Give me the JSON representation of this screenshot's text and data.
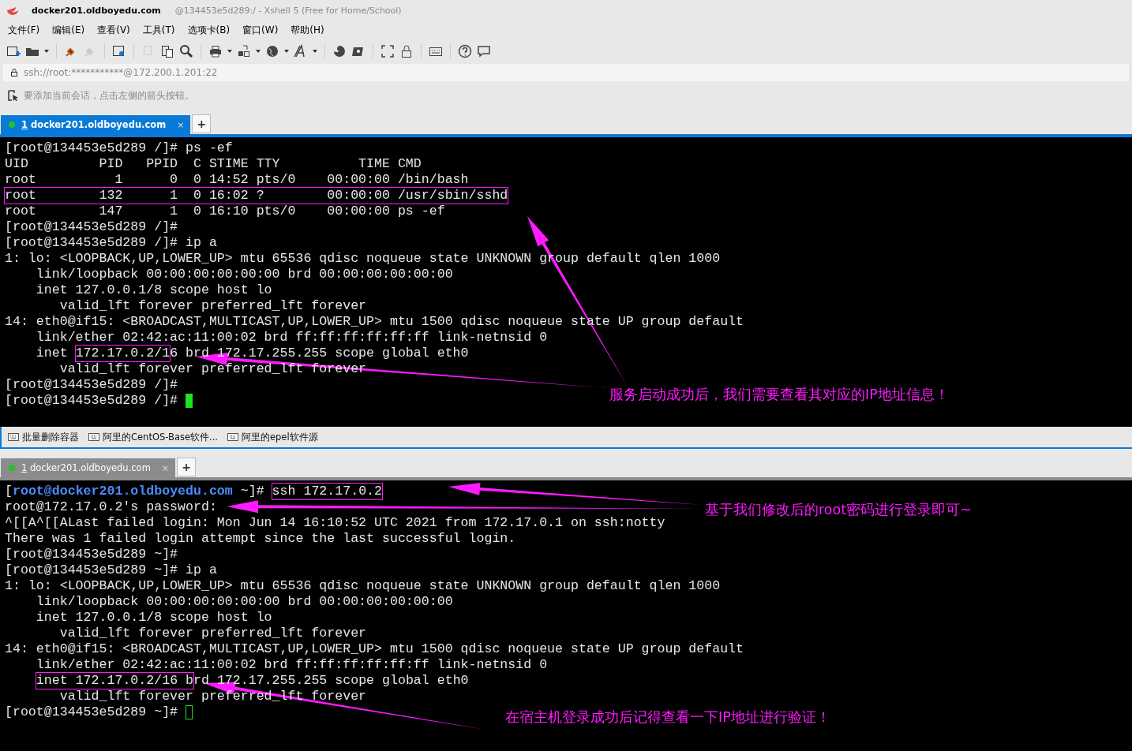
{
  "window": {
    "title": "docker201.oldboyedu.com",
    "subtitle": "@134453e5d289:/ - Xshell 5 (Free for Home/School)"
  },
  "menu": [
    "文件(F)",
    "编辑(E)",
    "查看(V)",
    "工具(T)",
    "选项卡(B)",
    "窗口(W)",
    "帮助(H)"
  ],
  "address": "ssh://root:***********@172.200.1.201:22",
  "hint": "要添加当前会话，点击左侧的箭头按钮。",
  "panes": [
    {
      "tabs": [
        {
          "number": "1",
          "title": "docker201.oldboyedu.com",
          "close": "×",
          "selected": true
        }
      ],
      "new_tab": "+",
      "lines": [
        {
          "text": "[root@134453e5d289 /]# ps -ef"
        },
        {
          "text": "UID         PID   PPID  C STIME TTY          TIME CMD"
        },
        {
          "text": "root          1      0  0 14:52 pts/0    00:00:00 /bin/bash"
        },
        {
          "segments": [
            {
              "text": "root        132      1  0 16:02 ?        00:00:00 /usr/sbin/sshd",
              "kind": "framed"
            }
          ]
        },
        {
          "text": "root        147      1  0 16:10 pts/0    00:00:00 ps -ef"
        },
        {
          "text": "[root@134453e5d289 /]#"
        },
        {
          "text": "[root@134453e5d289 /]# ip a"
        },
        {
          "text": "1: lo: <LOOPBACK,UP,LOWER_UP> mtu 65536 qdisc noqueue state UNKNOWN group default qlen 1000"
        },
        {
          "text": "    link/loopback 00:00:00:00:00:00 brd 00:00:00:00:00:00"
        },
        {
          "text": "    inet 127.0.0.1/8 scope host lo"
        },
        {
          "text": "       valid_lft forever preferred_lft forever"
        },
        {
          "text": "14: eth0@if15: <BROADCAST,MULTICAST,UP,LOWER_UP> mtu 1500 qdisc noqueue state UP group default"
        },
        {
          "text": "    link/ether 02:42:ac:11:00:02 brd ff:ff:ff:ff:ff:ff link-netnsid 0"
        },
        {
          "segments": [
            {
              "text": "    inet ",
              "kind": "plain"
            },
            {
              "text": "172.17.0.2/1",
              "kind": "framed"
            },
            {
              "text": "6 brd 172.17.255.255 scope global eth0",
              "kind": "plain"
            }
          ]
        },
        {
          "text": "       valid_lft forever preferred_lft forever"
        },
        {
          "text": "[root@134453e5d289 /]#"
        },
        {
          "text": "[root@134453e5d289 /]# "
        }
      ],
      "cursor_focused": true,
      "notes": [
        "服务启动成功后，我们需要查看其对应的IP地址信息！"
      ]
    },
    {
      "tabs": [
        {
          "number": "1",
          "title": "docker201.oldboyedu.com",
          "close": "×",
          "selected": false
        }
      ],
      "new_tab": "+",
      "lines": [
        {
          "segments": [
            {
              "text": "[",
              "kind": "plain"
            },
            {
              "text": "root@docker201.oldboyedu.com",
              "kind": "host"
            },
            {
              "text": " ~]#",
              "kind": "plain"
            },
            {
              "text": " ssh 172.17.0.2",
              "kind": "framed"
            }
          ]
        },
        {
          "text": "root@172.17.0.2's password:"
        },
        {
          "text": "^[[A^[[ALast failed login: Mon Jun 14 16:10:52 UTC 2021 from 172.17.0.1 on ssh:notty"
        },
        {
          "text": "There was 1 failed login attempt since the last successful login."
        },
        {
          "text": "[root@134453e5d289 ~]#"
        },
        {
          "text": "[root@134453e5d289 ~]# ip a"
        },
        {
          "text": "1: lo: <LOOPBACK,UP,LOWER_UP> mtu 65536 qdisc noqueue state UNKNOWN group default qlen 1000"
        },
        {
          "text": "    link/loopback 00:00:00:00:00:00 brd 00:00:00:00:00:00"
        },
        {
          "text": "    inet 127.0.0.1/8 scope host lo"
        },
        {
          "text": "       valid_lft forever preferred_lft forever"
        },
        {
          "text": "14: eth0@if15: <BROADCAST,MULTICAST,UP,LOWER_UP> mtu 1500 qdisc noqueue state UP group default"
        },
        {
          "text": "    link/ether 02:42:ac:11:00:02 brd ff:ff:ff:ff:ff:ff link-netnsid 0"
        },
        {
          "segments": [
            {
              "text": "    inet 172.17.0.2/16 b",
              "kind": "framed"
            },
            {
              "text": "rd 172.17.255.255 scope global eth0",
              "kind": "plain"
            }
          ]
        },
        {
          "text": "       valid_lft forever preferred_lft forever"
        },
        {
          "text": "[root@134453e5d289 ~]# "
        }
      ],
      "cursor_focused": false,
      "notes": [
        "基于我们修改后的root密码进行登录即可~",
        "在宿主机登录成功后记得查看一下IP地址进行验证！"
      ]
    }
  ],
  "quick_commands": [
    "批量删除容器",
    "阿里的CentOS-Base软件...",
    "阿里的epel软件源"
  ]
}
